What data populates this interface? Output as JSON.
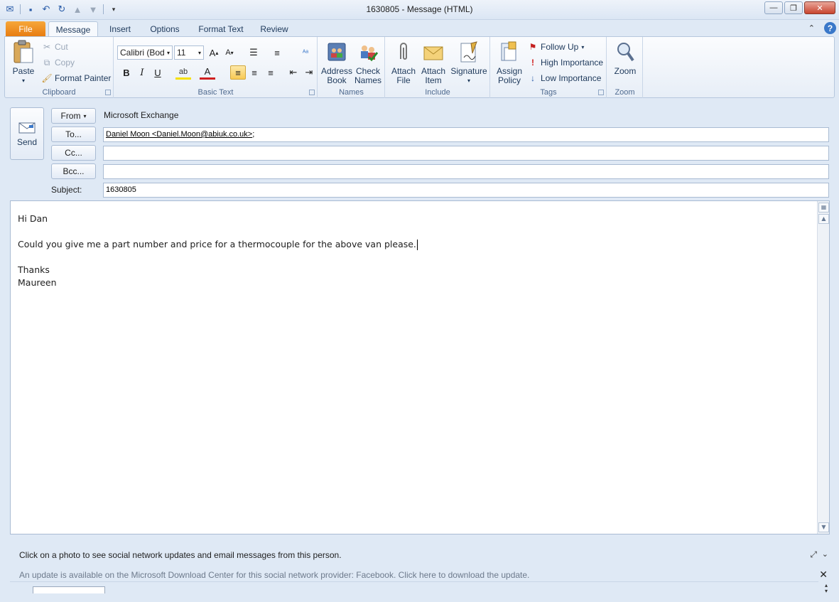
{
  "window": {
    "title": "1630805 - Message (HTML)"
  },
  "tabs": {
    "file": "File",
    "message": "Message",
    "insert": "Insert",
    "options": "Options",
    "format_text": "Format Text",
    "review": "Review"
  },
  "ribbon": {
    "clipboard": {
      "label": "Clipboard",
      "paste": "Paste",
      "cut": "Cut",
      "copy": "Copy",
      "format_painter": "Format Painter"
    },
    "basic_text": {
      "label": "Basic Text",
      "font": "Calibri (Bod",
      "size": "11"
    },
    "names": {
      "label": "Names",
      "address_book": [
        "Address",
        "Book"
      ],
      "check_names": [
        "Check",
        "Names"
      ]
    },
    "include": {
      "label": "Include",
      "attach_file": [
        "Attach",
        "File"
      ],
      "attach_item": [
        "Attach",
        "Item"
      ],
      "signature": "Signature"
    },
    "tags": {
      "label": "Tags",
      "assign_policy": [
        "Assign",
        "Policy"
      ],
      "follow_up": "Follow Up",
      "high_importance": "High Importance",
      "low_importance": "Low Importance"
    },
    "zoom": {
      "label": "Zoom",
      "zoom": "Zoom"
    }
  },
  "header": {
    "send": "Send",
    "from_btn": "From",
    "from_value": "Microsoft Exchange",
    "to_btn": "To...",
    "to_value": "Daniel Moon <Daniel.Moon@abiuk.co.uk>",
    "to_suffix": ";",
    "cc_btn": "Cc...",
    "cc_value": "",
    "bcc_btn": "Bcc...",
    "bcc_value": "",
    "subject_label": "Subject:",
    "subject_value": "1630805"
  },
  "body": {
    "greeting": "Hi Dan",
    "line1": "Could you give me a part number and price for a thermocouple for the above van please.",
    "closing": "Thanks",
    "signature": "Maureen"
  },
  "people_pane": {
    "info": "Click on a photo to see social network updates and email messages from this person.",
    "update": "An update is available on the Microsoft Download Center for this social network provider: Facebook. Click here to download the update."
  },
  "colors": {
    "file_tab": "#e77b0f",
    "accent": "#3a78c9",
    "highlight": "#f8c955"
  }
}
